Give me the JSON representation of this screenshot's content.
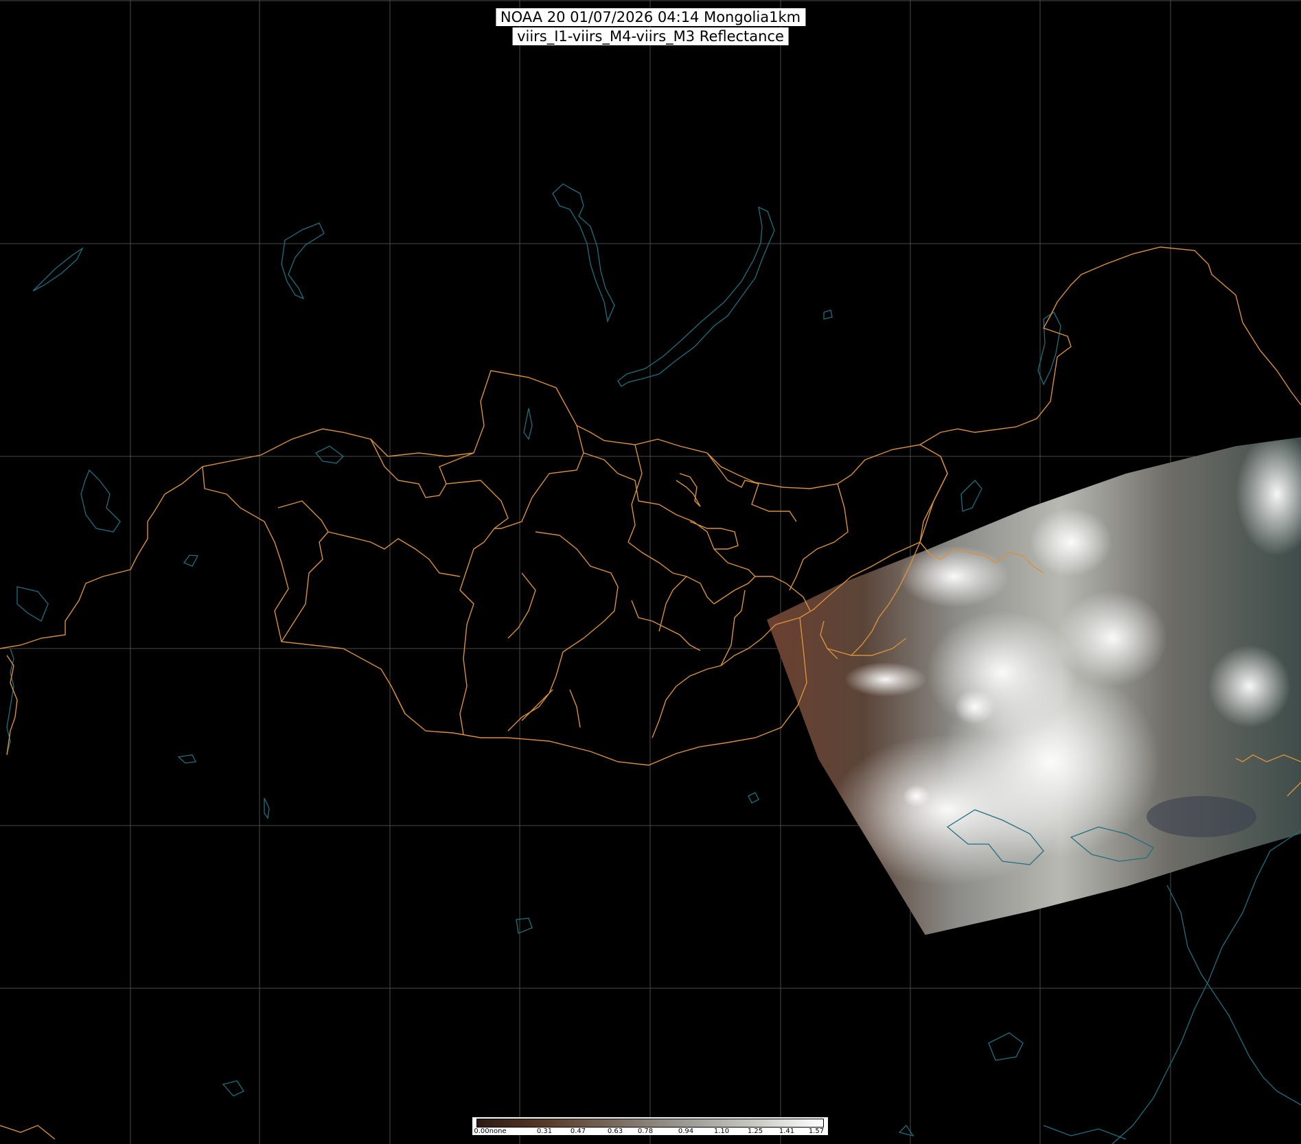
{
  "title": {
    "line1": "NOAA 20 01/07/2026 04:14 Mongolia1km",
    "line2": "viirs_I1-viirs_M4-viirs_M3 Reflectance"
  },
  "colorbar": {
    "min_label": "0.00none",
    "ticks": [
      "0.31",
      "0.47",
      "0.63",
      "0.78",
      "0.94",
      "1.10",
      "1.25",
      "1.41",
      "1.57"
    ],
    "colors": [
      "#2b1a12",
      "#5a3a28",
      "#7a6a5e",
      "#9a9a92",
      "#c8c8c2",
      "#ffffff"
    ]
  },
  "map": {
    "background": "#000000",
    "graticule_color": "#4a4a4a",
    "boundary_color": "#d9913a",
    "coastline_color": "#1e6f7f",
    "swath_dark_color": "#4f3426",
    "swath_cloud_color": "#d8d8d8"
  },
  "icons": {
    "map": "satellite-image-map",
    "colorbar": "reflectance-colorbar"
  }
}
